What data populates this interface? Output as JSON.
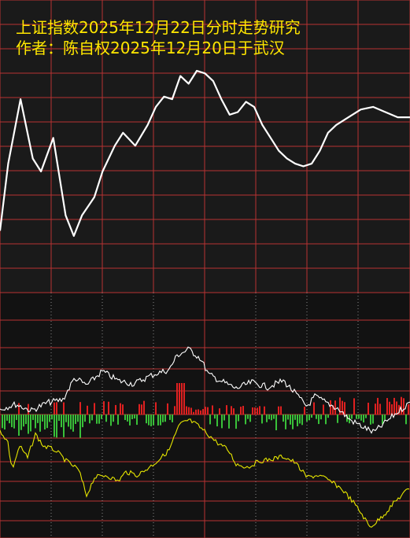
{
  "title": {
    "line1": "上证指数2025年12月22日分时走势研究",
    "line2": "作者：陈自权2025年12月20日于武汉"
  },
  "colors": {
    "background": "#1a1a1a",
    "grid": "#b83232",
    "price_line": "#ffffff",
    "yellow_line": "#e6e600",
    "up_bar": "#e02020",
    "down_bar": "#39c039",
    "title": "#ffe600"
  },
  "chart_data": [
    {
      "type": "line",
      "name": "intraday-forecast",
      "grid": true,
      "series": [
        {
          "points": [
            [
              0,
              0.22
            ],
            [
              0.02,
              0.48
            ],
            [
              0.05,
              0.73
            ],
            [
              0.08,
              0.5
            ],
            [
              0.1,
              0.45
            ],
            [
              0.13,
              0.58
            ],
            [
              0.16,
              0.28
            ],
            [
              0.18,
              0.2
            ],
            [
              0.2,
              0.28
            ],
            [
              0.23,
              0.35
            ],
            [
              0.25,
              0.45
            ],
            [
              0.28,
              0.55
            ],
            [
              0.3,
              0.6
            ],
            [
              0.33,
              0.55
            ],
            [
              0.36,
              0.63
            ],
            [
              0.38,
              0.7
            ],
            [
              0.4,
              0.74
            ],
            [
              0.42,
              0.73
            ],
            [
              0.44,
              0.82
            ],
            [
              0.46,
              0.79
            ],
            [
              0.48,
              0.84
            ],
            [
              0.5,
              0.83
            ],
            [
              0.52,
              0.8
            ],
            [
              0.54,
              0.73
            ],
            [
              0.56,
              0.67
            ],
            [
              0.58,
              0.68
            ],
            [
              0.6,
              0.72
            ],
            [
              0.62,
              0.7
            ],
            [
              0.64,
              0.63
            ],
            [
              0.66,
              0.58
            ],
            [
              0.68,
              0.53
            ],
            [
              0.7,
              0.5
            ],
            [
              0.72,
              0.48
            ],
            [
              0.74,
              0.47
            ],
            [
              0.76,
              0.48
            ],
            [
              0.78,
              0.53
            ],
            [
              0.8,
              0.6
            ],
            [
              0.82,
              0.63
            ],
            [
              0.85,
              0.66
            ],
            [
              0.88,
              0.69
            ],
            [
              0.91,
              0.7
            ],
            [
              0.94,
              0.68
            ],
            [
              0.97,
              0.66
            ],
            [
              1.0,
              0.66
            ]
          ]
        }
      ]
    },
    {
      "type": "line",
      "name": "volume-breadth-panel",
      "grid": true,
      "series": [
        {
          "name": "white"
        },
        {
          "name": "yellow"
        },
        {
          "name": "bars"
        }
      ]
    }
  ]
}
